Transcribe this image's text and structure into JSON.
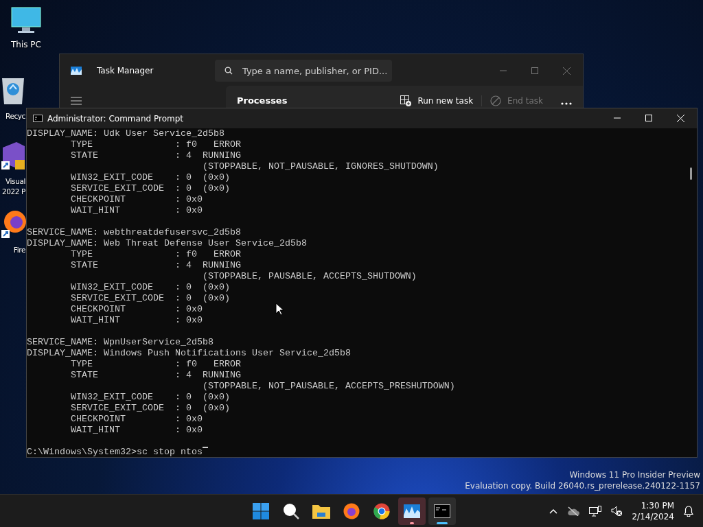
{
  "desktop_icons": [
    {
      "kind": "pc",
      "label": [
        "This PC"
      ]
    },
    {
      "kind": "recycle",
      "label": [
        "Recyc"
      ]
    },
    {
      "kind": "vs",
      "label": [
        "Visual",
        "2022 P"
      ]
    },
    {
      "kind": "firefox",
      "label": [
        "Fire"
      ]
    }
  ],
  "task_manager": {
    "title": "Task Manager",
    "search": {
      "placeholder": "Type a name, publisher, or PID..."
    },
    "page_title": "Processes",
    "toolbar": [
      {
        "kind": "run",
        "label": "Run new task",
        "disabled": false
      },
      {
        "kind": "end",
        "label": "End task",
        "disabled": true
      }
    ]
  },
  "command_prompt": {
    "title": "Administrator: Command Prompt",
    "blocks": [
      [
        "DISPLAY_NAME: Udk User Service_2d5b8",
        "        TYPE               : f0   ERROR",
        "        STATE              : 4  RUNNING",
        "                                (STOPPABLE, NOT_PAUSABLE, IGNORES_SHUTDOWN)",
        "        WIN32_EXIT_CODE    : 0  (0x0)",
        "        SERVICE_EXIT_CODE  : 0  (0x0)",
        "        CHECKPOINT         : 0x0",
        "        WAIT_HINT          : 0x0"
      ],
      [
        "SERVICE_NAME: webthreatdefusersvc_2d5b8",
        "DISPLAY_NAME: Web Threat Defense User Service_2d5b8",
        "        TYPE               : f0   ERROR",
        "        STATE              : 4  RUNNING",
        "                                (STOPPABLE, PAUSABLE, ACCEPTS_SHUTDOWN)",
        "        WIN32_EXIT_CODE    : 0  (0x0)",
        "        SERVICE_EXIT_CODE  : 0  (0x0)",
        "        CHECKPOINT         : 0x0",
        "        WAIT_HINT          : 0x0"
      ],
      [
        "SERVICE_NAME: WpnUserService_2d5b8",
        "DISPLAY_NAME: Windows Push Notifications User Service_2d5b8",
        "        TYPE               : f0   ERROR",
        "        STATE              : 4  RUNNING",
        "                                (STOPPABLE, NOT_PAUSABLE, ACCEPTS_PRESHUTDOWN)",
        "        WIN32_EXIT_CODE    : 0  (0x0)",
        "        SERVICE_EXIT_CODE  : 0  (0x0)",
        "        CHECKPOINT         : 0x0",
        "        WAIT_HINT          : 0x0"
      ]
    ],
    "prompt": "C:\\Windows\\System32>sc stop ntos"
  },
  "watermark": [
    "Windows 11 Pro Insider Preview",
    "Evaluation copy. Build 26040.rs_prerelease.240122-1157"
  ],
  "taskbar": {
    "apps": [
      {
        "kind": "start",
        "running": false,
        "selected": false,
        "attention": false
      },
      {
        "kind": "search",
        "running": false,
        "selected": false,
        "attention": false
      },
      {
        "kind": "explorer",
        "running": false,
        "selected": false,
        "attention": false
      },
      {
        "kind": "firefox",
        "running": false,
        "selected": false,
        "attention": false
      },
      {
        "kind": "chrome",
        "running": false,
        "selected": false,
        "attention": false
      },
      {
        "kind": "taskmgr",
        "running": true,
        "selected": false,
        "attention": true
      },
      {
        "kind": "cmd",
        "running": true,
        "selected": true,
        "attention": false
      }
    ],
    "time": "1:30 PM",
    "date": "2/14/2024"
  }
}
